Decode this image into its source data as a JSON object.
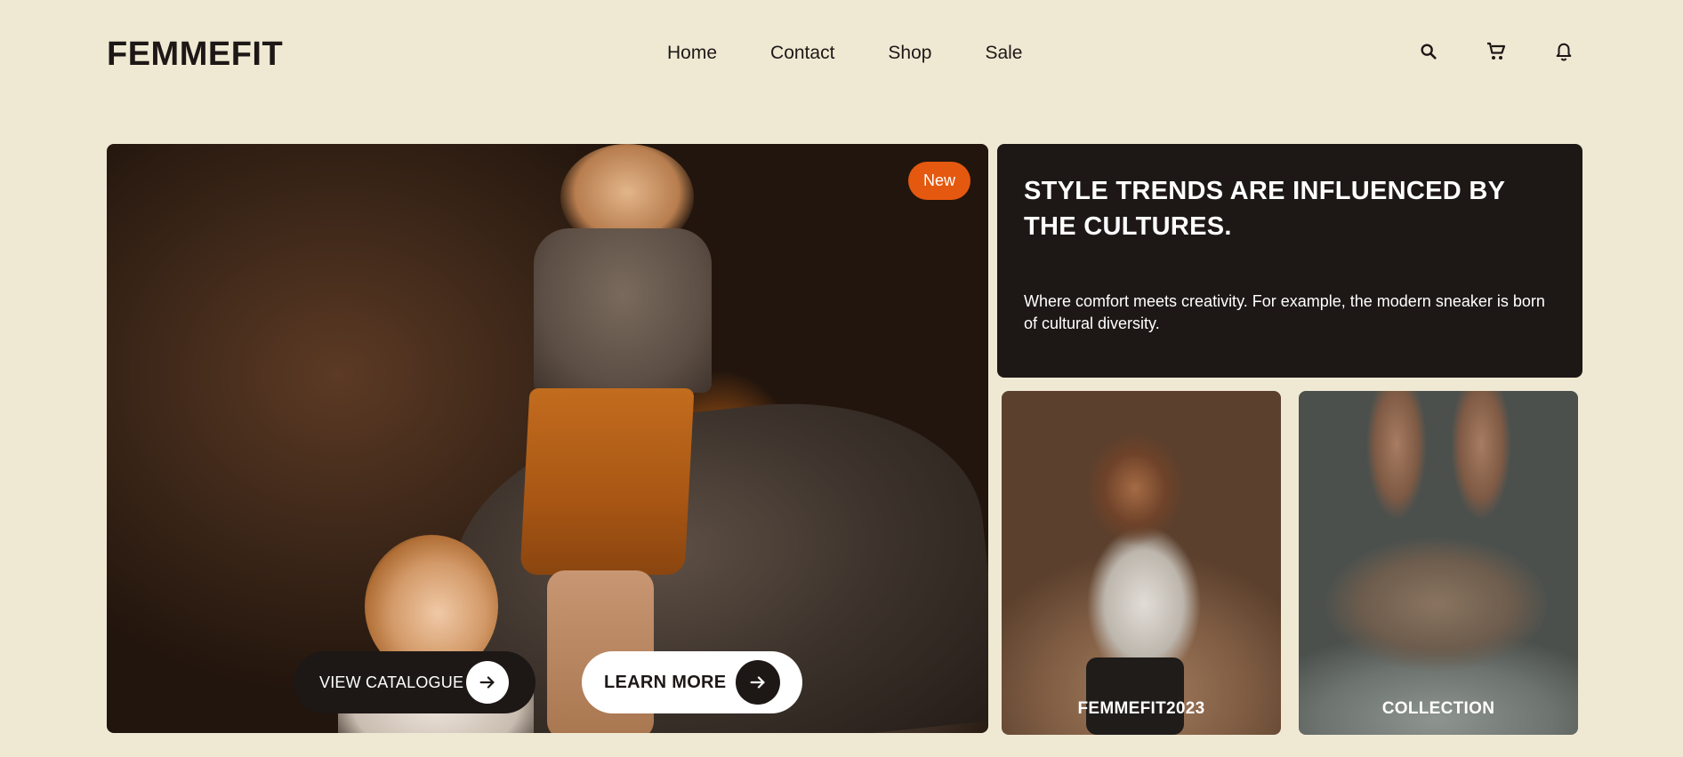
{
  "brand": "FEMMEFIT",
  "nav": [
    "Home",
    "Contact",
    "Shop",
    "Sale"
  ],
  "header_icons": [
    "search-icon",
    "cart-icon",
    "bell-icon"
  ],
  "hero": {
    "badge": "New",
    "catalogue_button": "VIEW CATALOGUE",
    "learn_more_button": "LEARN MORE"
  },
  "info": {
    "title": "STYLE TRENDS ARE INFLUENCED BY THE CULTURES.",
    "text": "Where comfort meets creativity. For example, the modern sneaker is born of cultural diversity."
  },
  "cards": [
    "FEMMEFIT2023",
    "COLLECTION"
  ],
  "colors": {
    "background": "#efe9d4",
    "dark": "#1d1816",
    "accent": "#e4580f"
  }
}
